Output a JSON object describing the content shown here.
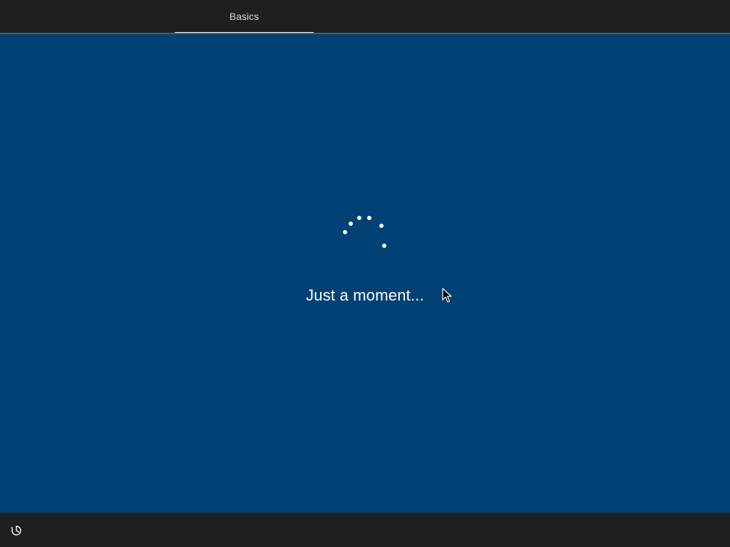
{
  "header": {
    "steps": [
      {
        "label": "Basics",
        "active": true
      }
    ]
  },
  "main": {
    "status_text": "Just a moment...",
    "spinner_icon": "loading-dots-icon"
  },
  "footer": {
    "ease_of_access_icon": "ease-of-access-icon"
  },
  "colors": {
    "background": "#004275",
    "bar": "#1f1f1f",
    "text": "#ffffff",
    "tab_text": "#d6d6d6"
  }
}
